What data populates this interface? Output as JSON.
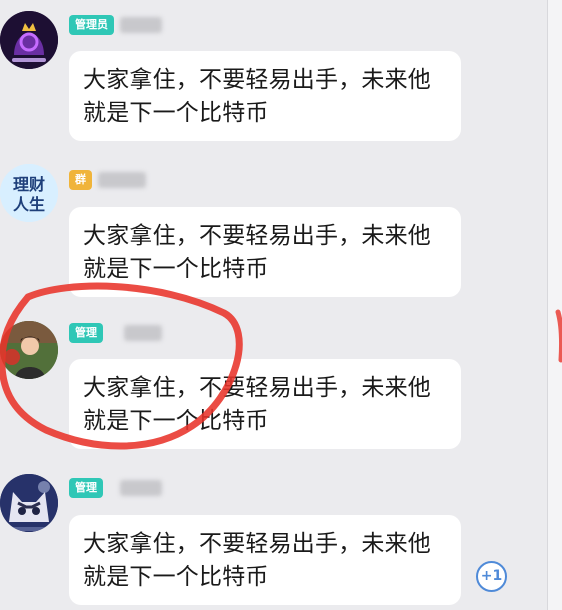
{
  "messages": [
    {
      "avatar_icon": "crown-avatar-icon",
      "badge": "管理员",
      "badge_color": "#2fc7b6",
      "text": "大家拿住，不要轻易出手，未来他就是下一个比特币"
    },
    {
      "avatar_icon": "finance-life-avatar-icon",
      "avatar_text": "理财\n人生",
      "badge": "群",
      "badge_color": "#f0b43a",
      "text": "大家拿住，不要轻易出手，未来他就是下一个比特币"
    },
    {
      "avatar_icon": "person-avatar-icon",
      "badge": "管理",
      "badge_color": "#2fc7b6",
      "text": "大家拿住，不要轻易出手，未来他就是下一个比特币"
    },
    {
      "avatar_icon": "cat-avatar-icon",
      "badge": "管理",
      "badge_color": "#2fc7b6",
      "text": "大家拿住，不要轻易出手，未来他就是下一个比特币"
    }
  ],
  "plus_one": {
    "label": "+1",
    "color": "#4f8ad8"
  },
  "colors": {
    "background": "#ebebee",
    "bubble": "#ffffff",
    "admin_badge": "#2fc7b6",
    "group_badge": "#f0b43a",
    "annotation_circle": "#e8332a"
  }
}
